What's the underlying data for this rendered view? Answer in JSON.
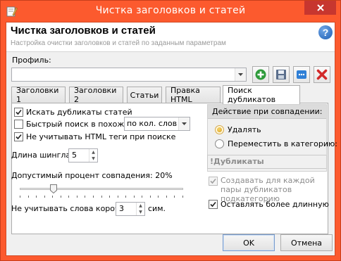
{
  "window": {
    "title": "Чистка заголовков и статей",
    "accent": "#fc5a2e"
  },
  "header": {
    "title": "Чистка заголовков и статей",
    "subtitle": "Настройка очистки заголовков и статей по заданным параметрам",
    "help_symbol": "?"
  },
  "profile": {
    "label": "Профиль:",
    "value": ""
  },
  "toolbar": {
    "icons": [
      "add-icon",
      "save-icon",
      "more-icon",
      "delete-icon"
    ],
    "add_color": "#2e9b3b",
    "delete_color": "#d22a2a"
  },
  "tabs": [
    {
      "label": "Заголовки 1",
      "active": false
    },
    {
      "label": "Заголовки 2",
      "active": false
    },
    {
      "label": "Статьи",
      "active": false
    },
    {
      "label": "Правка HTML",
      "active": false
    },
    {
      "label": "Поиск дубликатов",
      "active": true
    }
  ],
  "panel": {
    "search_duplicates": {
      "label": "Искать дубликаты статей",
      "checked": true
    },
    "quick_search": {
      "label": "Быстрый поиск в похожих",
      "checked": false
    },
    "quick_mode": {
      "value": "по кол. слов"
    },
    "ignore_html": {
      "label": "Не учитывать HTML теги при поиске",
      "checked": true
    },
    "shingle": {
      "label": "Длина шингла:",
      "value": "5"
    },
    "match_percent": {
      "label": "Допустимый процент совпадения: 20%",
      "value_percent": 20
    },
    "short_words": {
      "label": "Не учитывать слова короче",
      "value": "3",
      "unit": "сим."
    },
    "action_group": {
      "header": "Действие при совпадении:",
      "options": [
        {
          "label": "Удалять",
          "selected": true
        },
        {
          "label": "Переместить в категорию:",
          "selected": false
        }
      ]
    },
    "duplicates_field": "!Дубликаты",
    "create_subcategory": {
      "label": "Создавать для каждой пары дубликатов подкатегорию",
      "checked": true,
      "disabled": true
    },
    "keep_longer": {
      "label": "Оставлять более длинную",
      "checked": true
    }
  },
  "buttons": {
    "ok": "OK",
    "cancel": "Отмена"
  }
}
